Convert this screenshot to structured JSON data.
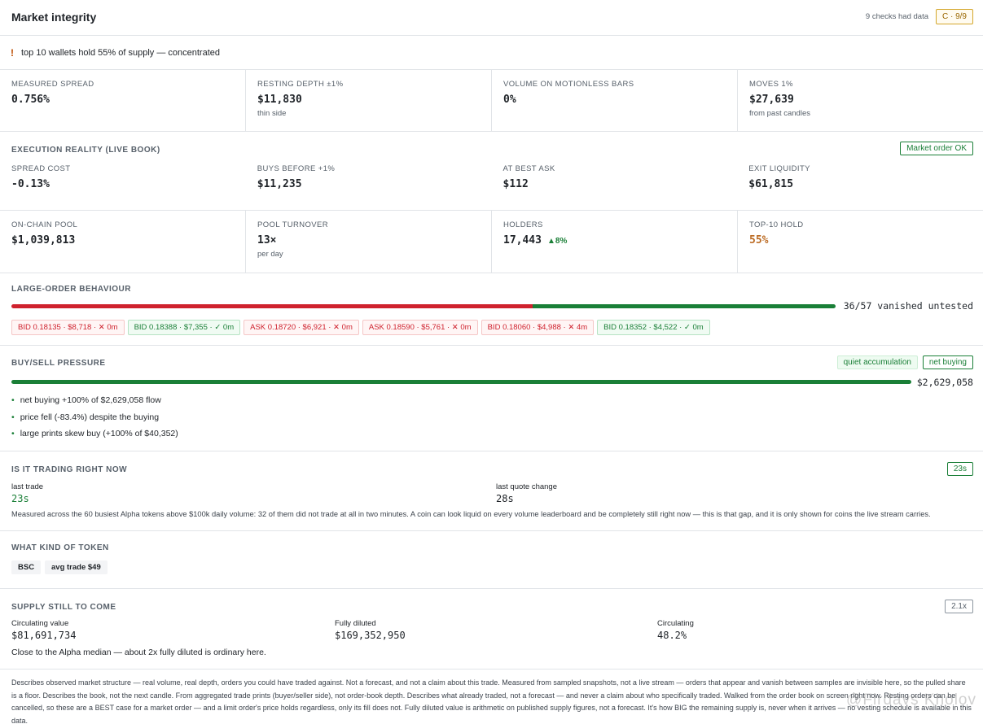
{
  "header": {
    "title": "Market integrity",
    "checks_text": "9 checks had data",
    "grade": "C · 9/9"
  },
  "alert": {
    "icon": "!",
    "text": "top 10 wallets hold 55% of supply — concentrated"
  },
  "metrics_top": [
    {
      "label": "MEASURED SPREAD",
      "value": "0.756%",
      "sub": ""
    },
    {
      "label": "RESTING DEPTH ±1%",
      "value": "$11,830",
      "sub": "thin side"
    },
    {
      "label": "VOLUME ON MOTIONLESS BARS",
      "value": "0%",
      "sub": ""
    },
    {
      "label": "MOVES 1%",
      "value": "$27,639",
      "sub": "from past candles"
    }
  ],
  "execution": {
    "title": "EXECUTION REALITY (LIVE BOOK)",
    "badge": "Market order OK",
    "metrics": [
      {
        "label": "SPREAD COST",
        "value": "-0.13%"
      },
      {
        "label": "BUYS BEFORE +1%",
        "value": "$11,235"
      },
      {
        "label": "AT BEST ASK",
        "value": "$112"
      },
      {
        "label": "EXIT LIQUIDITY",
        "value": "$61,815"
      }
    ]
  },
  "pool": {
    "metrics": [
      {
        "label": "ON-CHAIN POOL",
        "value": "$1,039,813",
        "sub": "",
        "extra": ""
      },
      {
        "label": "POOL TURNOVER",
        "value": "13×",
        "sub": "per day",
        "extra": ""
      },
      {
        "label": "HOLDERS",
        "value": "17,443",
        "sub": "",
        "extra": "▲8%"
      },
      {
        "label": "TOP-10 HOLD",
        "value": "55%",
        "sub": "",
        "extra": ""
      }
    ]
  },
  "large_orders": {
    "title": "LARGE-ORDER BEHAVIOUR",
    "vanished_fraction": 0.632,
    "summary": "36/57 vanished untested",
    "colors": {
      "vanished": "#cf222e",
      "tested": "#1a7f37"
    },
    "chips": [
      {
        "text": "BID 0.18135 · $8,718 · ✕ 0m",
        "kind": "bid-x"
      },
      {
        "text": "BID 0.18388 · $7,355 · ✓ 0m",
        "kind": "bid-ok"
      },
      {
        "text": "ASK 0.18720 · $6,921 · ✕ 0m",
        "kind": "ask-x"
      },
      {
        "text": "ASK 0.18590 · $5,761 · ✕ 0m",
        "kind": "ask-x"
      },
      {
        "text": "BID 0.18060 · $4,988 · ✕ 4m",
        "kind": "bid-x"
      },
      {
        "text": "BID 0.18352 · $4,522 · ✓ 0m",
        "kind": "bid-ok"
      }
    ]
  },
  "pressure": {
    "title": "BUY/SELL PRESSURE",
    "tag1": "quiet accumulation",
    "tag2": "net buying",
    "buy_fraction": 1.0,
    "total": "$2,629,058",
    "bullets": [
      "net buying +100% of $2,629,058 flow",
      "price fell (-83.4%) despite the buying",
      "large prints skew buy (+100% of $40,352)"
    ]
  },
  "trading": {
    "title": "IS IT TRADING RIGHT NOW",
    "badge": "23s",
    "last_trade_label": "last trade",
    "last_trade_value": "23s",
    "last_quote_label": "last quote change",
    "last_quote_value": "28s",
    "note": "Measured across the 60 busiest Alpha tokens above $100k daily volume: 32 of them did not trade at all in two minutes. A coin can look liquid on every volume leaderboard and be completely still right now — this is that gap, and it is only shown for coins the live stream carries."
  },
  "token": {
    "title": "WHAT KIND OF TOKEN",
    "chain": "BSC",
    "avg_trade": "avg trade $49"
  },
  "supply": {
    "title": "SUPPLY STILL TO COME",
    "badge": "2.1x",
    "items": [
      {
        "label": "Circulating value",
        "value": "$81,691,734"
      },
      {
        "label": "Fully diluted",
        "value": "$169,352,950"
      },
      {
        "label": "Circulating",
        "value": "48.2%"
      }
    ],
    "note": "Close to the Alpha median — about 2x fully diluted is ordinary here."
  },
  "footer": {
    "text": "Describes observed market structure — real volume, real depth, orders you could have traded against. Not a forecast, and not a claim about this trade. Measured from sampled snapshots, not a live stream — orders that appear and vanish between samples are invisible here, so the pulled share is a floor. Describes the book, not the next candle. From aggregated trade prints (buyer/seller side), not order-book depth. Describes what already traded, not a forecast — and never a claim about who specifically traded. Walked from the order book on screen right now. Resting orders can be cancelled, so these are a BEST case for a market order — and a limit order's price holds regardless, only its fill does not. Fully diluted value is arithmetic on published supply figures, not a forecast. It's how BIG the remaining supply is, never when it arrives — no vesting schedule is available in this data.",
    "watermark": "@Firdavs Kholov"
  }
}
